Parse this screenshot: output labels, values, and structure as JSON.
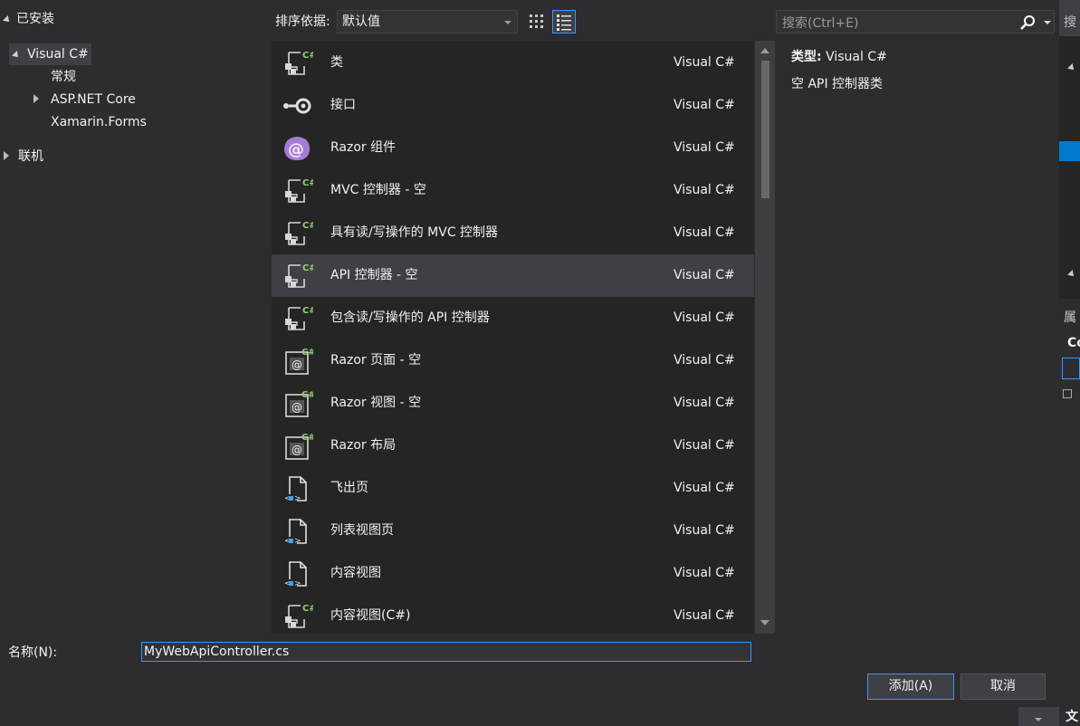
{
  "tree": {
    "installed": "已安装",
    "visual_csharp": "Visual C#",
    "general": "常规",
    "aspnet_core": "ASP.NET Core",
    "xamarin_forms": "Xamarin.Forms",
    "online": "联机"
  },
  "toolbar": {
    "sort_label": "排序依据:",
    "sort_value": "默认值",
    "search_placeholder": "搜索(Ctrl+E)"
  },
  "templates": [
    {
      "name": "类",
      "lang": "Visual C#",
      "icon": "csharp-class-icon"
    },
    {
      "name": "接口",
      "lang": "Visual C#",
      "icon": "interface-icon"
    },
    {
      "name": "Razor 组件",
      "lang": "Visual C#",
      "icon": "razor-component-icon"
    },
    {
      "name": "MVC 控制器 - 空",
      "lang": "Visual C#",
      "icon": "csharp-class-icon"
    },
    {
      "name": "具有读/写操作的 MVC 控制器",
      "lang": "Visual C#",
      "icon": "csharp-class-icon"
    },
    {
      "name": "API 控制器 - 空",
      "lang": "Visual C#",
      "icon": "csharp-class-icon",
      "selected": true
    },
    {
      "name": "包含读/写操作的 API 控制器",
      "lang": "Visual C#",
      "icon": "csharp-class-icon"
    },
    {
      "name": "Razor 页面 - 空",
      "lang": "Visual C#",
      "icon": "razor-page-icon"
    },
    {
      "name": "Razor 视图 - 空",
      "lang": "Visual C#",
      "icon": "razor-page-icon"
    },
    {
      "name": "Razor 布局",
      "lang": "Visual C#",
      "icon": "razor-page-icon"
    },
    {
      "name": "飞出页",
      "lang": "Visual C#",
      "icon": "xaml-page-icon"
    },
    {
      "name": "列表视图页",
      "lang": "Visual C#",
      "icon": "xaml-page-icon"
    },
    {
      "name": "内容视图",
      "lang": "Visual C#",
      "icon": "xaml-page-icon"
    },
    {
      "name": "内容视图(C#)",
      "lang": "Visual C#",
      "icon": "csharp-class-icon"
    }
  ],
  "details": {
    "type_label": "类型:",
    "type_value": "Visual C#",
    "description": "空 API 控制器类"
  },
  "strip": {
    "search_fragment": "搜",
    "props_fragment": "属",
    "co_fragment": "Co",
    "wen_fragment": "文"
  },
  "form": {
    "name_label": "名称(N):",
    "name_value": "MyWebApiController.cs",
    "add_label": "添加(A)",
    "cancel_label": "取消"
  },
  "colors": {
    "background": "#2d2d30",
    "list_bg": "#252526",
    "selection": "#3f3f46",
    "accent": "#3399ff",
    "csharp_green": "#8fd16a",
    "razor_purple": "#a67bd6"
  }
}
